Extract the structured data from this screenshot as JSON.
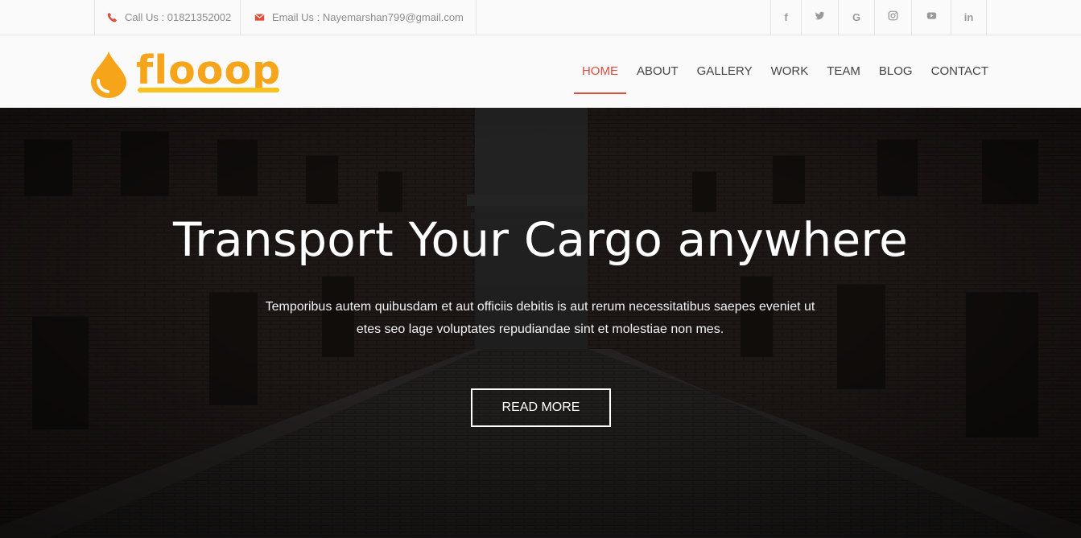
{
  "topbar": {
    "phone": {
      "icon": "phone-icon",
      "text": "Call Us : 01821352002"
    },
    "email": {
      "icon": "envelope-icon",
      "text": "Email Us : Nayemarshan799@gmail.com"
    },
    "socials": [
      {
        "name": "facebook-icon",
        "glyph": "f"
      },
      {
        "name": "twitter-icon",
        "glyph": ""
      },
      {
        "name": "google-icon",
        "glyph": "G"
      },
      {
        "name": "instagram-icon",
        "glyph": ""
      },
      {
        "name": "youtube-icon",
        "glyph": ""
      },
      {
        "name": "linkedin-icon",
        "glyph": "in"
      }
    ]
  },
  "header": {
    "logo_text": "flooop",
    "nav": [
      {
        "label": "HOME",
        "active": true
      },
      {
        "label": "ABOUT"
      },
      {
        "label": "GALLERY"
      },
      {
        "label": "WORK"
      },
      {
        "label": "TEAM"
      },
      {
        "label": "BLOG"
      },
      {
        "label": "CONTACT"
      }
    ]
  },
  "hero": {
    "title": "Transport Your Cargo anywhere",
    "subtitle": "Temporibus autem quibusdam et aut officiis debitis is aut rerum necessitatibus saepes eveniet ut etes seo lage voluptates repudiandae sint et molestiae non mes.",
    "button": "READ MORE"
  },
  "colors": {
    "accent": "#e04b3a",
    "logo_orange": "#f6a419",
    "logo_yellow": "#f8c21a",
    "topbar_bg": "#fafafa"
  }
}
